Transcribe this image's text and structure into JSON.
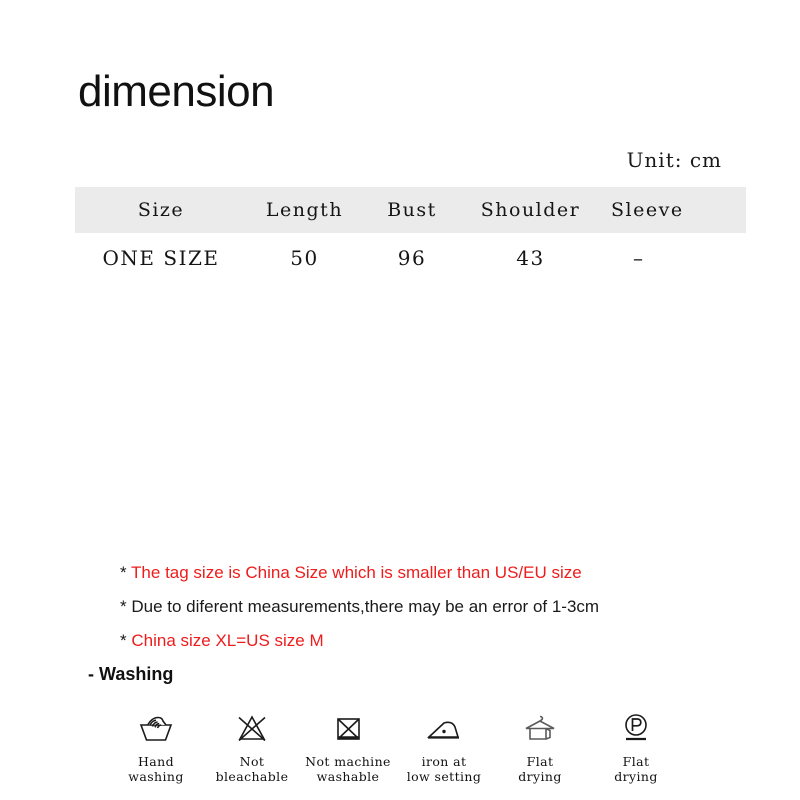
{
  "header": {
    "title": "dimension",
    "unit_label": "Unit: cm"
  },
  "size_table": {
    "columns": [
      "Size",
      "Length",
      "Bust",
      "Shoulder",
      "Sleeve"
    ],
    "rows": [
      {
        "size": "ONE SIZE",
        "length": "50",
        "bust": "96",
        "shoulder": "43",
        "sleeve": "–"
      }
    ]
  },
  "notes": [
    {
      "star": "*",
      "text": "The tag size is China Size which is smaller than US/EU size",
      "color": "red"
    },
    {
      "star": "*",
      "text": "Due to diferent measurements,there may be an error of 1-3cm",
      "color": "black"
    },
    {
      "star": "*",
      "text": "China size XL=US size M",
      "color": "red"
    }
  ],
  "washing": {
    "heading": "- Washing",
    "symbols": [
      {
        "icon": "hand-washing-icon",
        "label": "Hand\nwashing"
      },
      {
        "icon": "not-bleachable-icon",
        "label": "Not\nbleachable"
      },
      {
        "icon": "not-machine-washable-icon",
        "label": "Not machine\nwashable"
      },
      {
        "icon": "iron-low-setting-icon",
        "label": "iron at\nlow setting"
      },
      {
        "icon": "flat-drying-hanger-icon",
        "label": "Flat\ndrying"
      },
      {
        "icon": "dry-clean-p-icon",
        "label": "Flat\ndrying"
      }
    ]
  },
  "colors": {
    "note_red": "#ee1c1c",
    "table_header_bg": "#ebebeb",
    "text": "#1a1a1a"
  }
}
